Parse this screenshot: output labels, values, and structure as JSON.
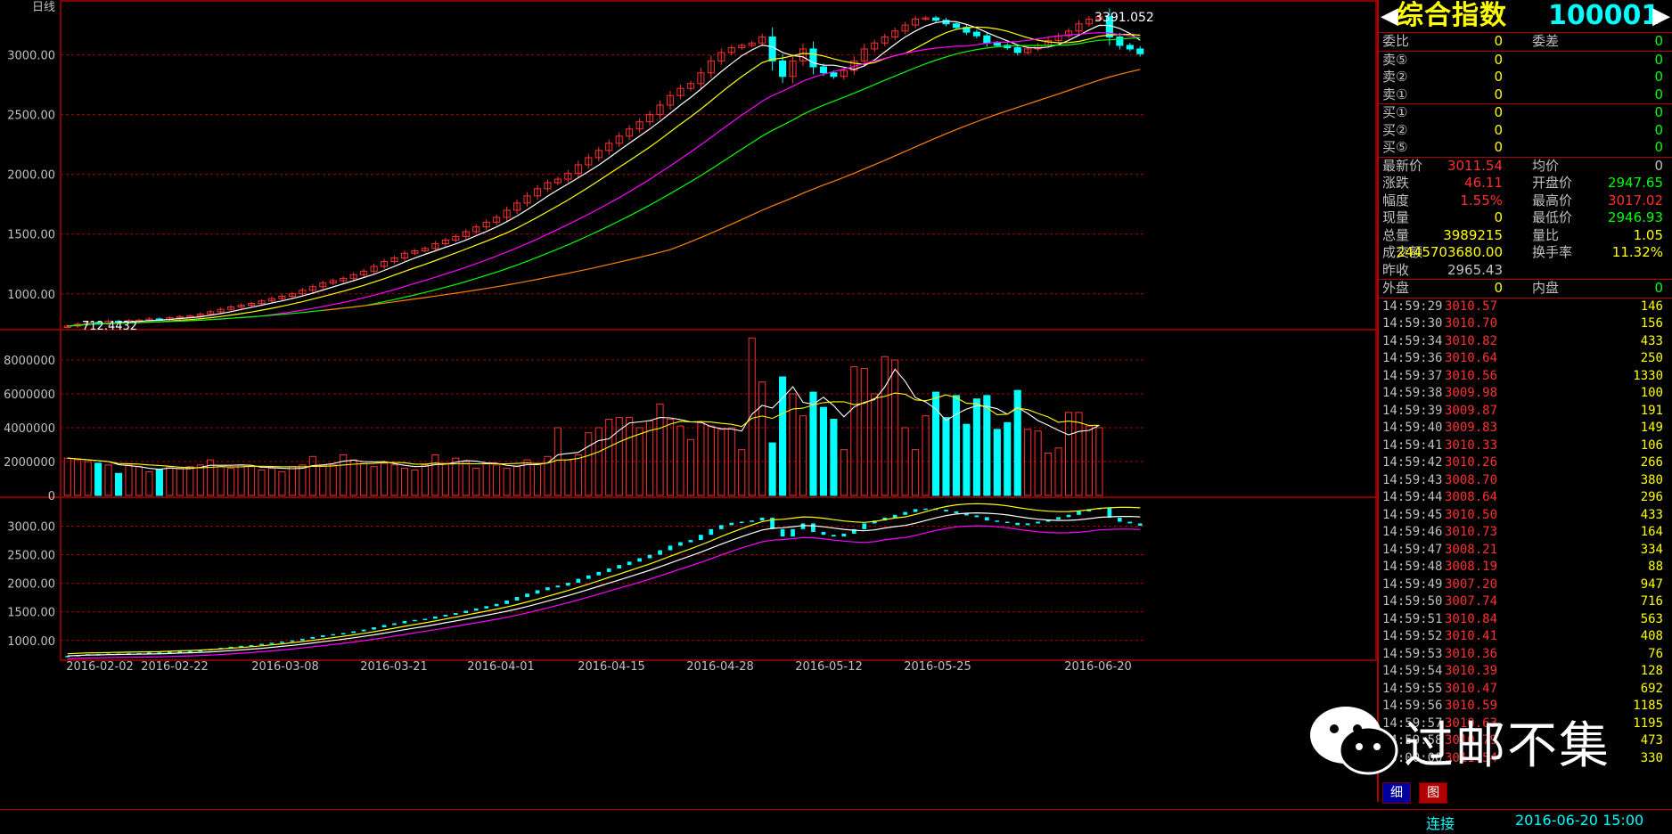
{
  "chart": {
    "period_label": "日线",
    "last_high_label": "3391.052",
    "start_low_label": "712.4432",
    "upper_ticks": [
      "3000.00",
      "2500.00",
      "2000.00",
      "1500.00",
      "1000.00"
    ],
    "volume_ticks": [
      "8000000",
      "6000000",
      "4000000",
      "2000000",
      "0"
    ],
    "lower_ticks": [
      "3000.00",
      "2500.00",
      "2000.00",
      "1500.00",
      "1000.00"
    ],
    "dates": [
      "2016-02-02",
      "2016-02-22",
      "2016-03-08",
      "2016-03-21",
      "2016-04-01",
      "2016-04-15",
      "2016-04-28",
      "2016-05-12",
      "2016-05-25",
      "2016-06-20"
    ]
  },
  "chart_data": {
    "type": "candlestick",
    "price_axis": {
      "min": 700,
      "max": 3400,
      "ticks": [
        1000,
        1500,
        2000,
        2500,
        3000
      ]
    },
    "volume_axis": {
      "min": 0,
      "max": 9000000,
      "ticks": [
        0,
        2000000,
        4000000,
        6000000,
        8000000
      ]
    },
    "candles_close": [
      730,
      745,
      760,
      755,
      770,
      765,
      775,
      780,
      790,
      785,
      800,
      810,
      815,
      830,
      850,
      870,
      890,
      905,
      920,
      940,
      960,
      980,
      1000,
      1030,
      1060,
      1090,
      1110,
      1130,
      1160,
      1190,
      1230,
      1270,
      1300,
      1340,
      1360,
      1380,
      1420,
      1450,
      1480,
      1520,
      1560,
      1600,
      1640,
      1700,
      1760,
      1820,
      1880,
      1930,
      1960,
      2010,
      2080,
      2140,
      2200,
      2260,
      2320,
      2380,
      2440,
      2500,
      2580,
      2660,
      2720,
      2760,
      2850,
      2950,
      3020,
      3060,
      3080,
      3100,
      3150,
      2950,
      2820,
      2950,
      3050,
      2900,
      2850,
      2820,
      2870,
      2950,
      3050,
      3100,
      3150,
      3200,
      3250,
      3300,
      3310,
      3290,
      3260,
      3230,
      3190,
      3160,
      3100,
      3080,
      3060,
      3020,
      3050,
      3080,
      3120,
      3160,
      3200,
      3260,
      3300,
      3320,
      3150,
      3080,
      3050,
      3010
    ],
    "volumes": [
      2200000,
      2100000,
      2000000,
      1900000,
      1800000,
      1300000,
      1800000,
      1700000,
      1400000,
      1500000,
      1700000,
      1600000,
      1700000,
      1800000,
      2100000,
      1700000,
      1600000,
      1800000,
      1700000,
      1500000,
      1600000,
      1400000,
      1700000,
      1800000,
      2300000,
      1800000,
      1800000,
      2400000,
      2100000,
      1900000,
      1700000,
      1900000,
      1800000,
      1600000,
      1500000,
      1800000,
      2400000,
      1900000,
      2200000,
      2000000,
      1600000,
      1900000,
      1800000,
      1600000,
      1700000,
      2100000,
      1900000,
      2300000,
      4000000,
      2100000,
      2400000,
      3700000,
      4000000,
      4500000,
      4600000,
      4600000,
      4000000,
      4400000,
      5400000,
      4500000,
      4100000,
      3300000,
      4300000,
      4100000,
      3900000,
      4000000,
      2700000,
      9300000,
      6700000,
      3100000,
      7000000,
      6000000,
      4700000,
      6100000,
      5200000,
      4500000,
      2700000,
      7600000,
      7500000,
      6000000,
      8200000,
      8000000,
      4000000,
      2700000,
      4700000,
      6100000,
      4600000,
      5900000,
      4200000,
      5700000,
      5900000,
      3900000,
      4300000,
      6200000,
      3900000,
      3800000,
      2500000,
      2800000,
      4900000,
      4900000,
      4100000,
      4000000
    ]
  },
  "quote": {
    "name": "综合指数",
    "code": "100001",
    "rows_top": [
      {
        "label": "委比",
        "value": "0",
        "label2": "委差",
        "value2": "0"
      }
    ],
    "sell": [
      {
        "label": "卖⑤",
        "value": "0",
        "value2": "0"
      },
      {
        "label": "卖②",
        "value": "0",
        "value2": "0"
      },
      {
        "label": "卖①",
        "value": "0",
        "value2": "0"
      }
    ],
    "buy": [
      {
        "label": "买①",
        "value": "0",
        "value2": "0"
      },
      {
        "label": "买②",
        "value": "0",
        "value2": "0"
      },
      {
        "label": "买⑤",
        "value": "0",
        "value2": "0"
      }
    ],
    "stats": [
      {
        "label": "最新价",
        "value": "3011.54",
        "label2": "均价",
        "value2": "0",
        "c1": "#ff3030",
        "c2": "#c0c0c0"
      },
      {
        "label": "涨跌",
        "value": "46.11",
        "label2": "开盘价",
        "value2": "2947.65",
        "c1": "#ff3030",
        "c2": "#00ff00"
      },
      {
        "label": "幅度",
        "value": "1.55%",
        "label2": "最高价",
        "value2": "3017.02",
        "c1": "#ff3030",
        "c2": "#ff3030"
      },
      {
        "label": "现量",
        "value": "0",
        "label2": "最低价",
        "value2": "2946.93",
        "c1": "#ffff00",
        "c2": "#00ff00"
      },
      {
        "label": "总量",
        "value": "3989215",
        "label2": "量比",
        "value2": "1.05",
        "c1": "#ffff00",
        "c2": "#ffff00"
      },
      {
        "label": "成交额",
        "value": "2445703680.00",
        "label2": "换手率",
        "value2": "11.32%",
        "c1": "#ffff00",
        "c2": "#ffff00"
      },
      {
        "label": "昨收",
        "value": "2965.43",
        "label2": "",
        "value2": "",
        "c1": "#c0c0c0",
        "c2": "#c0c0c0"
      }
    ],
    "outer_inner": {
      "label": "外盘",
      "value": "0",
      "label2": "内盘",
      "value2": "0"
    },
    "ticks": [
      {
        "time": "14:59:29",
        "price": "3010.57",
        "vol": "146"
      },
      {
        "time": "14:59:30",
        "price": "3010.70",
        "vol": "156"
      },
      {
        "time": "14:59:34",
        "price": "3010.82",
        "vol": "433"
      },
      {
        "time": "14:59:36",
        "price": "3010.64",
        "vol": "250"
      },
      {
        "time": "14:59:37",
        "price": "3010.56",
        "vol": "1330"
      },
      {
        "time": "14:59:38",
        "price": "3009.98",
        "vol": "100"
      },
      {
        "time": "14:59:39",
        "price": "3009.87",
        "vol": "191"
      },
      {
        "time": "14:59:40",
        "price": "3009.83",
        "vol": "149"
      },
      {
        "time": "14:59:41",
        "price": "3010.33",
        "vol": "106"
      },
      {
        "time": "14:59:42",
        "price": "3010.26",
        "vol": "266"
      },
      {
        "time": "14:59:43",
        "price": "3008.70",
        "vol": "380"
      },
      {
        "time": "14:59:44",
        "price": "3008.64",
        "vol": "296"
      },
      {
        "time": "14:59:45",
        "price": "3010.50",
        "vol": "433"
      },
      {
        "time": "14:59:46",
        "price": "3010.73",
        "vol": "164"
      },
      {
        "time": "14:59:47",
        "price": "3008.21",
        "vol": "334"
      },
      {
        "time": "14:59:48",
        "price": "3008.19",
        "vol": "88"
      },
      {
        "time": "14:59:49",
        "price": "3007.20",
        "vol": "947"
      },
      {
        "time": "14:59:50",
        "price": "3007.74",
        "vol": "716"
      },
      {
        "time": "14:59:51",
        "price": "3010.84",
        "vol": "563"
      },
      {
        "time": "14:59:52",
        "price": "3010.41",
        "vol": "408"
      },
      {
        "time": "14:59:53",
        "price": "3010.36",
        "vol": "76"
      },
      {
        "time": "14:59:54",
        "price": "3010.39",
        "vol": "128"
      },
      {
        "time": "14:59:55",
        "price": "3010.47",
        "vol": "692"
      },
      {
        "time": "14:59:56",
        "price": "3010.59",
        "vol": "1185"
      },
      {
        "time": "14:59:57",
        "price": "3010.63",
        "vol": "1195"
      },
      {
        "time": "14:59:58",
        "price": "3010.79",
        "vol": "473"
      },
      {
        "time": "15:00:00",
        "price": "3011.54",
        "vol": "330"
      }
    ],
    "tabs": [
      "细",
      "图"
    ]
  },
  "status": {
    "connection": "连接",
    "datetime": "2016-06-20 15:00"
  },
  "watermark": {
    "text": "过邮不集"
  },
  "colors": {
    "up": "#ff3030",
    "down": "#00ffff",
    "grid": "#b00000",
    "ma5": "#ffffff",
    "ma10": "#ffff00",
    "ma20": "#ff00ff",
    "ma30": "#00ff00",
    "ma60": "#ff8000"
  }
}
